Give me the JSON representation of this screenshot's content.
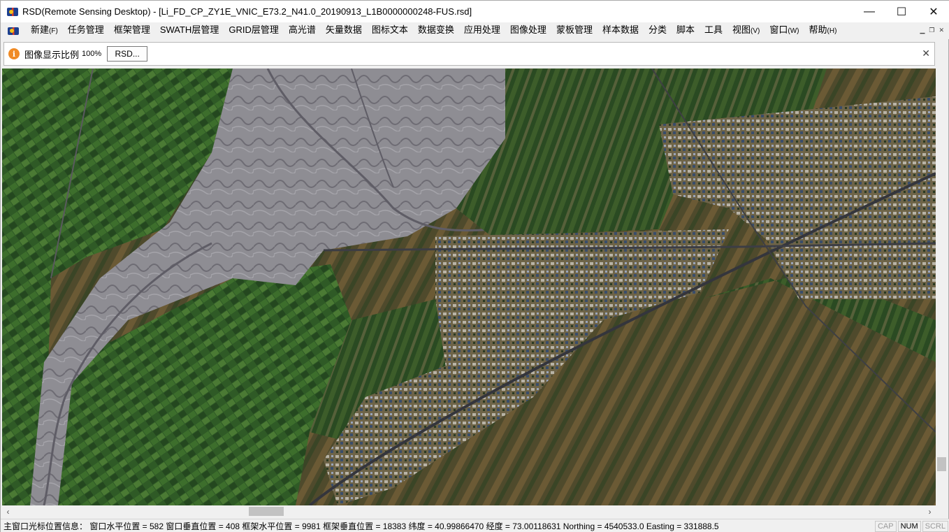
{
  "window": {
    "title": "RSD(Remote Sensing Desktop) - [Li_FD_CP_ZY1E_VNIC_E73.2_N41.0_20190913_L1B0000000248-FUS.rsd]",
    "minimize_glyph": "—",
    "maximize_glyph": "☐",
    "close_glyph": "✕"
  },
  "menu": {
    "items": [
      {
        "label": "新建",
        "accel": "(F)"
      },
      {
        "label": "任务管理",
        "accel": ""
      },
      {
        "label": "框架管理",
        "accel": ""
      },
      {
        "label": "SWATH层管理",
        "accel": ""
      },
      {
        "label": "GRID层管理",
        "accel": ""
      },
      {
        "label": "高光谱",
        "accel": ""
      },
      {
        "label": "矢量数据",
        "accel": ""
      },
      {
        "label": "图标文本",
        "accel": ""
      },
      {
        "label": "数据变换",
        "accel": ""
      },
      {
        "label": "应用处理",
        "accel": ""
      },
      {
        "label": "图像处理",
        "accel": ""
      },
      {
        "label": "蒙板管理",
        "accel": ""
      },
      {
        "label": "样本数据",
        "accel": ""
      },
      {
        "label": "分类",
        "accel": ""
      },
      {
        "label": "脚本",
        "accel": ""
      },
      {
        "label": "工具",
        "accel": ""
      },
      {
        "label": "视图",
        "accel": "(V)"
      },
      {
        "label": "窗口",
        "accel": "(W)"
      },
      {
        "label": "帮助",
        "accel": "(H)"
      }
    ],
    "mdi_minimize": "▁",
    "mdi_restore": "❐",
    "mdi_close": "✕"
  },
  "infobar": {
    "label": "图像显示比例",
    "zoom": "100%",
    "button_label": "RSD...",
    "icon_glyph": "i",
    "close_glyph": "✕"
  },
  "scroll": {
    "left_arrow": "‹",
    "right_arrow": "›"
  },
  "status": {
    "text": "主窗口光标位置信息：  窗口水平位置 = 582 窗口垂直位置 = 408 框架水平位置 = 9981 框架垂直位置 = 18383 纬度  = 40.99866470 经度 = 73.00118631 Northing = 4540533.0 Easting = 331888.5",
    "indicators": [
      {
        "label": "CAP",
        "active": false
      },
      {
        "label": "NUM",
        "active": true
      },
      {
        "label": "SCRL",
        "active": false
      }
    ]
  },
  "colors": {
    "farmland_green": "#2f5a26",
    "farmland_brown": "#6b5a35",
    "riverbed_grey": "#8b8a8f",
    "village_beige": "#8a7a5a"
  }
}
